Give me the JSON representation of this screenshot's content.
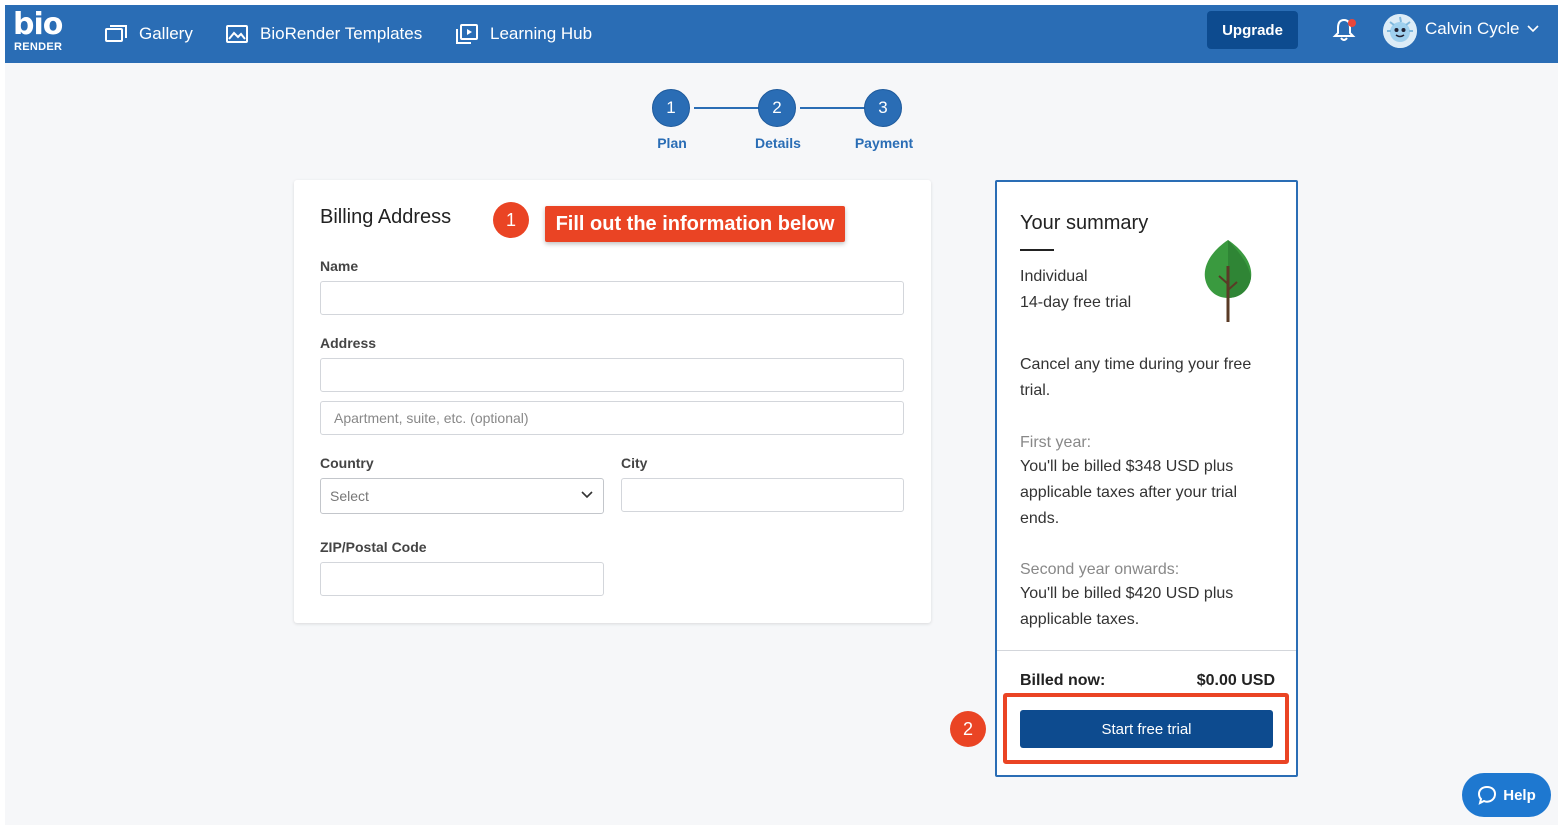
{
  "nav": {
    "logo_top": "bio",
    "logo_bottom": "RENDER",
    "items": [
      {
        "label": "Gallery",
        "icon": "gallery-icon"
      },
      {
        "label": "BioRender Templates",
        "icon": "image-icon"
      },
      {
        "label": "Learning Hub",
        "icon": "play-icon"
      }
    ],
    "upgrade_label": "Upgrade",
    "username": "Calvin Cycle"
  },
  "stepper": {
    "steps": [
      {
        "number": "1",
        "label": "Plan"
      },
      {
        "number": "2",
        "label": "Details"
      },
      {
        "number": "3",
        "label": "Payment"
      }
    ]
  },
  "billing": {
    "title": "Billing Address",
    "name_label": "Name",
    "name_value": "",
    "address_label": "Address",
    "address_value": "",
    "address2_placeholder": "Apartment, suite, etc. (optional)",
    "country_label": "Country",
    "country_value": "Select",
    "city_label": "City",
    "city_value": "",
    "zip_label": "ZIP/Postal Code",
    "zip_value": ""
  },
  "annotations": {
    "badge1": "1",
    "callout1": "Fill out the information below",
    "badge2": "2"
  },
  "summary": {
    "title": "Your summary",
    "plan": "Individual",
    "trial": "14-day free trial",
    "cancel_text": "Cancel any time during your free trial.",
    "first_year_label": "First year:",
    "first_year_text": "You'll be billed $348 USD plus applicable taxes after your trial ends.",
    "second_year_label": "Second year onwards:",
    "second_year_text": "You'll be billed $420 USD plus applicable taxes.",
    "billed_now_label": "Billed now:",
    "billed_now_value": "$0.00 USD",
    "cta_label": "Start free trial"
  },
  "help": {
    "label": "Help"
  },
  "colors": {
    "primary": "#2a6db5",
    "button_dark": "#0d4b8f",
    "annotation": "#ea4424",
    "tree_leaf": "#3a9a3f"
  }
}
